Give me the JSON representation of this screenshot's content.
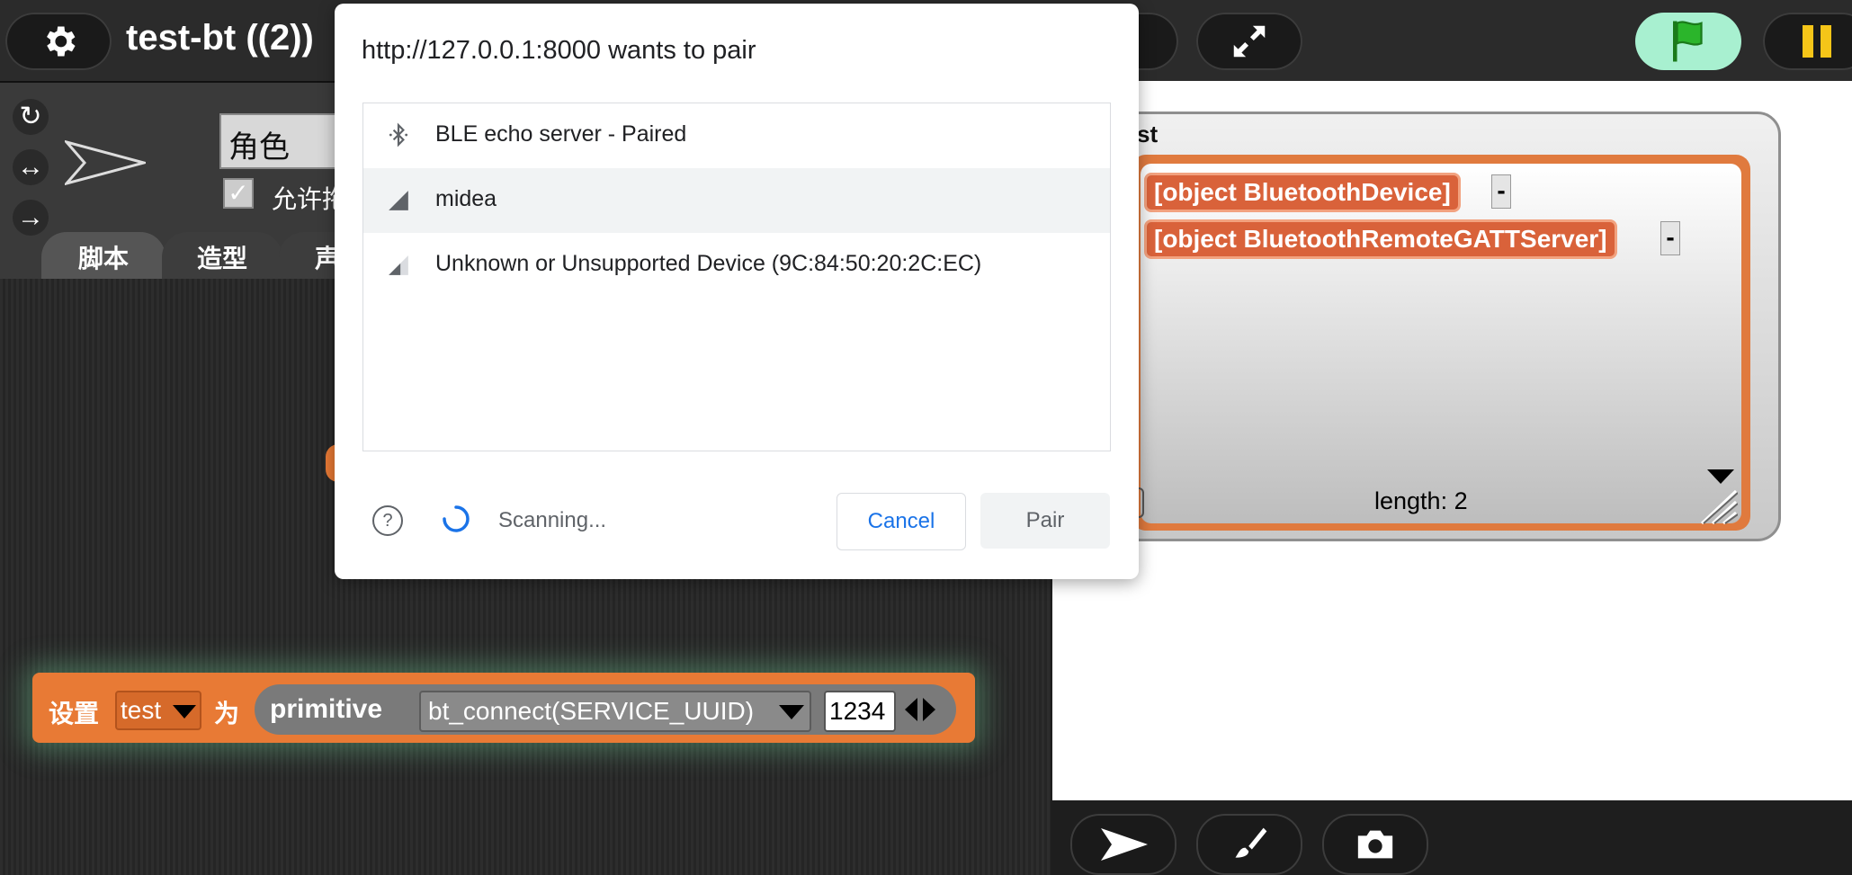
{
  "app": {
    "title": "test-bt ((2))"
  },
  "sprite": {
    "name_field": "角色",
    "checkbox_label": "允许拖",
    "tabs": [
      "脚本",
      "造型",
      "声"
    ]
  },
  "watcher": {
    "var_name_partial": "st",
    "items": [
      "[object BluetoothDevice]",
      "[object BluetoothRemoteGATTServer]"
    ],
    "dash": "-",
    "length_label": "length: 2"
  },
  "block": {
    "set_label": "设置",
    "var_value": "test",
    "to_label": "为",
    "primitive_label": "primitive",
    "dropdown_value": "bt_connect(SERVICE_UUID)",
    "number_value": "1234"
  },
  "dialog": {
    "title": "http://127.0.0.1:8000 wants to pair",
    "devices": [
      {
        "label": "BLE echo server - Paired",
        "icon": "bluetooth-icon"
      },
      {
        "label": "midea",
        "icon": "signal-strength-icon"
      },
      {
        "label": "Unknown or Unsupported Device (9C:84:50:20:2C:EC)",
        "icon": "signal-strength-icon"
      }
    ],
    "status": "Scanning...",
    "cancel_label": "Cancel",
    "pair_label": "Pair"
  },
  "colors": {
    "block_orange": "#e87a35",
    "green_flag_bg": "#a8f0d0",
    "pause_yellow": "#f5c518",
    "link_blue": "#1a73e8"
  }
}
